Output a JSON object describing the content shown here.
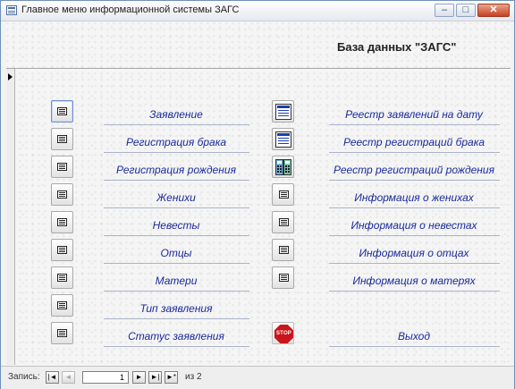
{
  "window": {
    "title": "Главное меню информационной системы ЗАГС",
    "minimize": "–",
    "maximize": "□",
    "close": "✕"
  },
  "header": {
    "db_title": "База данных \"ЗАГС\""
  },
  "menu_left": [
    {
      "label": "Заявление",
      "icon": "form-icon"
    },
    {
      "label": "Регистрация брака",
      "icon": "form-icon"
    },
    {
      "label": "Регистрация рождения",
      "icon": "form-icon"
    },
    {
      "label": "Женихи",
      "icon": "form-icon"
    },
    {
      "label": "Невесты",
      "icon": "form-icon"
    },
    {
      "label": "Отцы",
      "icon": "form-icon"
    },
    {
      "label": "Матери",
      "icon": "form-icon"
    },
    {
      "label": "Тип заявления",
      "icon": "form-icon"
    },
    {
      "label": "Статус заявления",
      "icon": "form-icon"
    }
  ],
  "menu_right": [
    {
      "label": "Реестр заявлений на дату",
      "icon": "report-icon"
    },
    {
      "label": "Реестр регистраций брака",
      "icon": "report-icon"
    },
    {
      "label": "Реестр регистраций рождения",
      "icon": "calculator-icon"
    },
    {
      "label": "Информация о женихах",
      "icon": "form-icon"
    },
    {
      "label": "Информация о невестах",
      "icon": "form-icon"
    },
    {
      "label": "Информация о отцах",
      "icon": "form-icon"
    },
    {
      "label": "Информация о матерях",
      "icon": "form-icon"
    },
    {
      "label": "Выход",
      "icon": "stop-icon",
      "stop_text": "STOP"
    }
  ],
  "nav": {
    "label": "Запись:",
    "first": "|◄",
    "prev": "◄",
    "current": "1",
    "next": "►",
    "last": "►|",
    "new": "►*",
    "of_text": "из 2"
  }
}
